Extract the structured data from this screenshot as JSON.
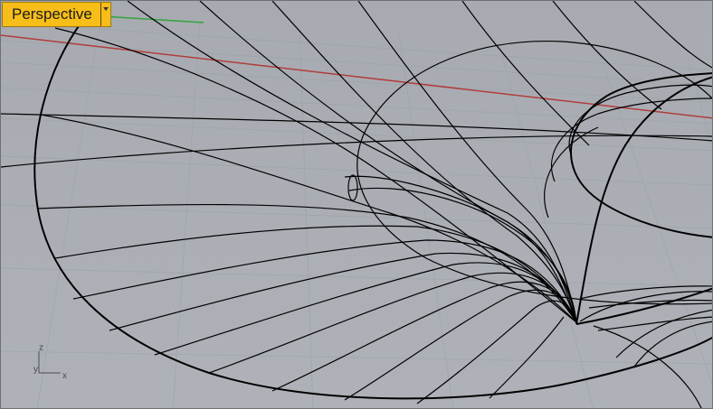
{
  "viewport": {
    "name": "Perspective",
    "menu_icon": "chevron-down-icon",
    "active_tab_color": "#f7bd18",
    "background_color": "#a9adb3"
  },
  "axis_widget": {
    "z_label": "z",
    "y_label": "y",
    "x_label": "x"
  },
  "scene": {
    "view": "perspective wireframe",
    "grid": true,
    "x_axis_color": "#b13c3c",
    "y_axis_color": "#33a33c",
    "curve_color": "#000000"
  }
}
